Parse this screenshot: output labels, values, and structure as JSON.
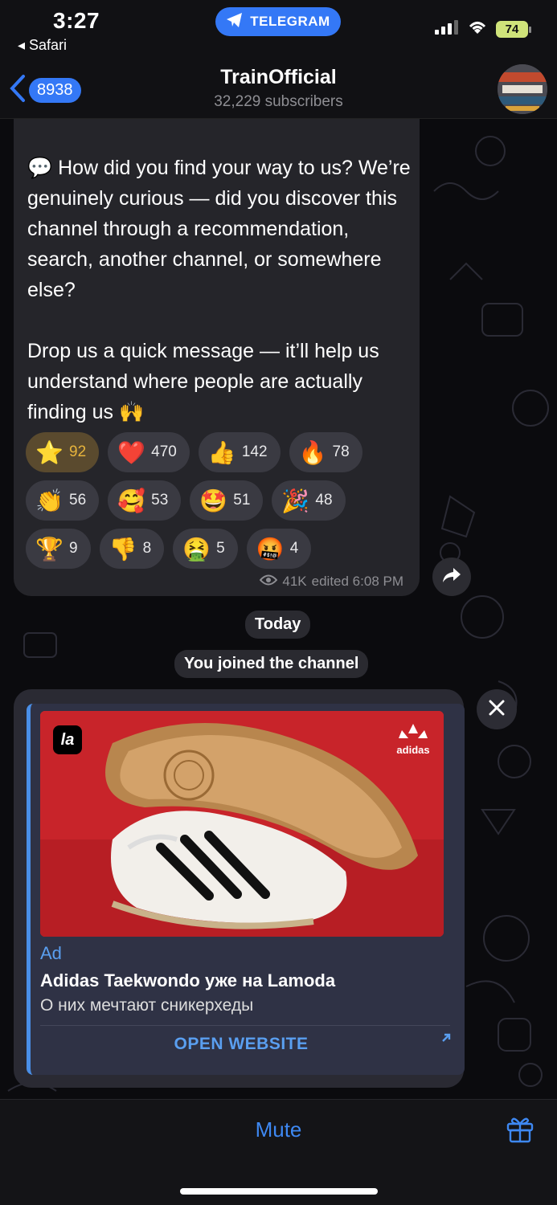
{
  "status_bar": {
    "time": "3:27",
    "back_app": "◂ Safari",
    "pill_label": "TELEGRAM",
    "battery": "74"
  },
  "header": {
    "back_count": "8938",
    "title": "TrainOfficial",
    "subtitle": "32,229 subscribers"
  },
  "message": {
    "paragraph1": "💬 How did you find your way to us? We’re genuinely curious — did you discover this channel through a recommendation, search, another channel, or somewhere else?",
    "paragraph2": "Drop us a quick message — it’ll help us understand where people are actually finding us 🙌",
    "reactions_rows": [
      [
        {
          "emoji": "⭐",
          "count": "92",
          "active": true
        },
        {
          "emoji": "❤️",
          "count": "470"
        },
        {
          "emoji": "👍",
          "count": "142"
        },
        {
          "emoji": "🔥",
          "count": "78"
        }
      ],
      [
        {
          "emoji": "👏",
          "count": "56"
        },
        {
          "emoji": "🥰",
          "count": "53"
        },
        {
          "emoji": "🤩",
          "count": "51"
        },
        {
          "emoji": "🎉",
          "count": "48"
        }
      ],
      [
        {
          "emoji": "🏆",
          "count": "9"
        },
        {
          "emoji": "👎",
          "count": "8"
        },
        {
          "emoji": "🤮",
          "count": "5"
        },
        {
          "emoji": "🤬",
          "count": "4"
        }
      ]
    ],
    "views": "41K",
    "edited": "edited 6:08 PM"
  },
  "service": {
    "today": "Today",
    "joined": "You joined the channel"
  },
  "ad": {
    "label": "Ad",
    "title": "Adidas Taekwondo уже на Lamoda",
    "description": "О них мечтают сникерхеды",
    "cta": "OPEN WEBSITE",
    "logo_left": "la",
    "logo_right": "adidas",
    "shoe_text": "adidas",
    "image_bg_color": "#c8242a"
  },
  "bottom": {
    "mute": "Mute"
  },
  "colors": {
    "accent": "#3478f6",
    "link": "#5a9ff0"
  }
}
